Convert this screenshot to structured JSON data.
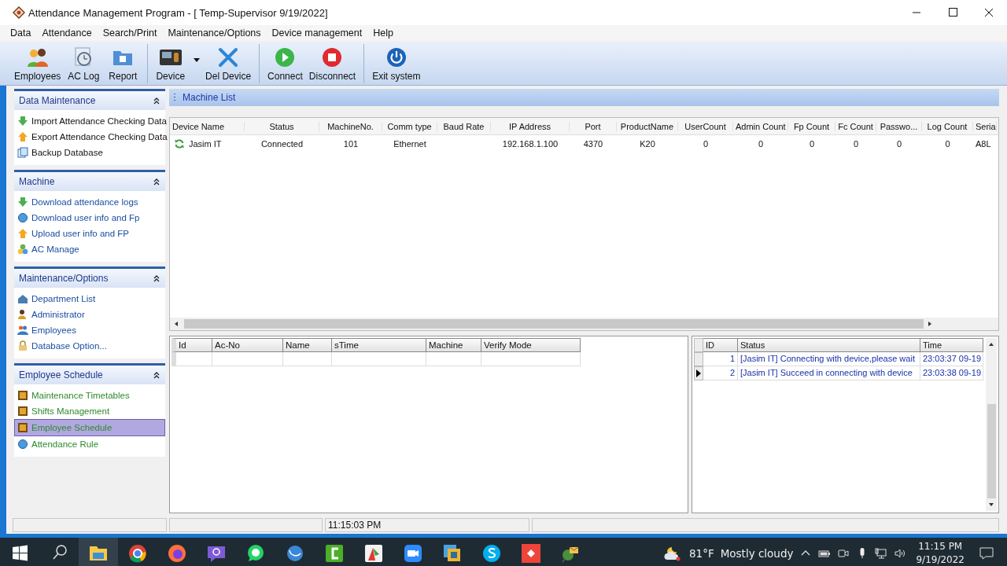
{
  "window": {
    "title": "Attendance Management Program - [ Temp-Supervisor 9/19/2022]"
  },
  "menu": [
    "Data",
    "Attendance",
    "Search/Print",
    "Maintenance/Options",
    "Device management",
    "Help"
  ],
  "toolbar": [
    [
      {
        "kind": "people",
        "label": "Employees",
        "dropdown": false
      },
      {
        "kind": "clock",
        "label": "AC Log",
        "dropdown": false
      },
      {
        "kind": "folder",
        "label": "Report",
        "dropdown": false
      }
    ],
    [
      {
        "kind": "device",
        "label": "Device",
        "dropdown": true
      },
      {
        "kind": "cross",
        "label": "Del Device",
        "dropdown": false
      }
    ],
    [
      {
        "kind": "play",
        "label": "Connect",
        "dropdown": false
      },
      {
        "kind": "stop",
        "label": "Disconnect",
        "dropdown": false
      }
    ],
    [
      {
        "kind": "power",
        "label": "Exit system",
        "dropdown": false
      }
    ]
  ],
  "sidebar": [
    {
      "title": "Data Maintenance",
      "expanded": true,
      "items": [
        {
          "kind": "down",
          "label": "Import Attendance Checking Data",
          "selected": false
        },
        {
          "kind": "up",
          "label": "Export Attendance Checking Data",
          "selected": false
        },
        {
          "kind": "doc",
          "label": "Backup Database",
          "selected": false
        }
      ]
    },
    {
      "title": "Machine",
      "expanded": true,
      "items": [
        {
          "kind": "down",
          "label": "Download attendance logs",
          "selected": false
        },
        {
          "kind": "orb",
          "label": "Download user info and Fp",
          "selected": false
        },
        {
          "kind": "up",
          "label": "Upload user info and FP",
          "selected": false
        },
        {
          "kind": "balls",
          "label": "AC Manage",
          "selected": false
        }
      ]
    },
    {
      "title": "Maintenance/Options",
      "expanded": true,
      "items": [
        {
          "kind": "house",
          "label": "Department List",
          "selected": false
        },
        {
          "kind": "person",
          "label": "Administrator",
          "selected": false
        },
        {
          "kind": "people",
          "label": "Employees",
          "selected": false
        },
        {
          "kind": "lock",
          "label": "Database Option...",
          "selected": false
        }
      ]
    },
    {
      "title": "Employee Schedule",
      "expanded": true,
      "items": [
        {
          "kind": "calendar",
          "label": "Maintenance Timetables",
          "selected": false
        },
        {
          "kind": "calendar",
          "label": "Shifts Management",
          "selected": false
        },
        {
          "kind": "calendar",
          "label": "Employee Schedule",
          "selected": true
        },
        {
          "kind": "orb",
          "label": "Attendance Rule",
          "selected": false
        }
      ]
    }
  ],
  "machine_list": {
    "title": "Machine List",
    "columns": [
      "Device Name",
      "Status",
      "MachineNo.",
      "Comm type",
      "Baud Rate",
      "IP Address",
      "Port",
      "ProductName",
      "UserCount",
      "Admin Count",
      "Fp Count",
      "Fc Count",
      "Passwo...",
      "Log Count",
      "Seria"
    ],
    "rows": [
      {
        "cells": [
          "Jasim IT",
          "Connected",
          "101",
          "Ethernet",
          "",
          "192.168.1.100",
          "4370",
          "K20",
          "0",
          "0",
          "0",
          "0",
          "0",
          "0",
          "A8L"
        ]
      }
    ]
  },
  "log_grid": {
    "columns": [
      "Id",
      "Ac-No",
      "Name",
      "sTime",
      "Machine",
      "Verify Mode"
    ]
  },
  "status_log": {
    "columns": [
      "ID",
      "Status",
      "Time"
    ],
    "rows": [
      {
        "cells": [
          "1",
          "[Jasim IT] Connecting with device,please wait",
          "23:03:37 09-19"
        ],
        "selected": false
      },
      {
        "cells": [
          "2",
          "[Jasim IT] Succeed in connecting with device",
          "23:03:38 09-19"
        ],
        "selected": true
      }
    ]
  },
  "status_bar": {
    "time": "11:15:03 PM"
  },
  "taskbar": {
    "apps": [
      {
        "kind": "folder",
        "selected": true
      },
      {
        "kind": "browser",
        "selected": false
      },
      {
        "kind": "fox",
        "selected": false
      },
      {
        "kind": "phone-bubble",
        "selected": false
      },
      {
        "kind": "chat",
        "selected": false
      },
      {
        "kind": "orb",
        "selected": false
      },
      {
        "kind": "green-square",
        "selected": false
      },
      {
        "kind": "chart",
        "selected": false
      },
      {
        "kind": "camera",
        "selected": false
      },
      {
        "kind": "squares",
        "selected": false
      },
      {
        "kind": "blue-circle",
        "selected": false
      },
      {
        "kind": "diamond",
        "selected": false
      },
      {
        "kind": "globe-mail",
        "selected": false
      }
    ],
    "weather": {
      "temperature": "81°F",
      "condition": "Mostly cloudy"
    },
    "clock": {
      "time": "11:15 PM",
      "date": "9/19/2022"
    }
  }
}
